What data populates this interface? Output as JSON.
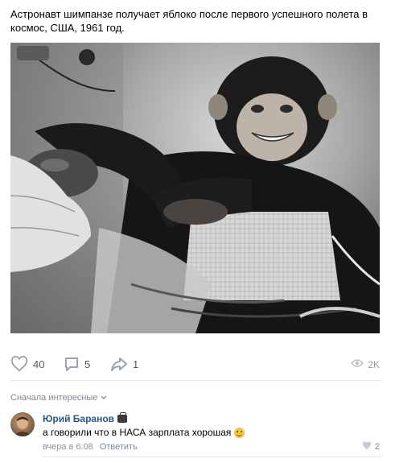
{
  "post": {
    "text": "Астронавт шимпанзе получает яблоко после первого успешного полета в космос, США, 1961 год."
  },
  "actions": {
    "likes": "40",
    "comments": "5",
    "shares": "1",
    "views": "2K"
  },
  "comments_section": {
    "sort_label": "Сначала интересные",
    "items": [
      {
        "author": "Юрий Баранов",
        "text": "а говорили что в НАСА зарплата хорошая",
        "time": "вчера в 6:08",
        "reply_label": "Ответить",
        "likes": "2"
      }
    ]
  },
  "icons": {
    "like": "heart-icon",
    "comment": "comment-icon",
    "share": "share-arrow-icon",
    "views": "eye-icon",
    "sort": "chevron-down-icon",
    "author_badge": "briefcase-icon",
    "emoji": "smiling-emoji-icon"
  },
  "colors": {
    "link": "#2a5885",
    "muted": "#939393",
    "divider": "#e7e8ec",
    "icon": "#99a2ad"
  }
}
